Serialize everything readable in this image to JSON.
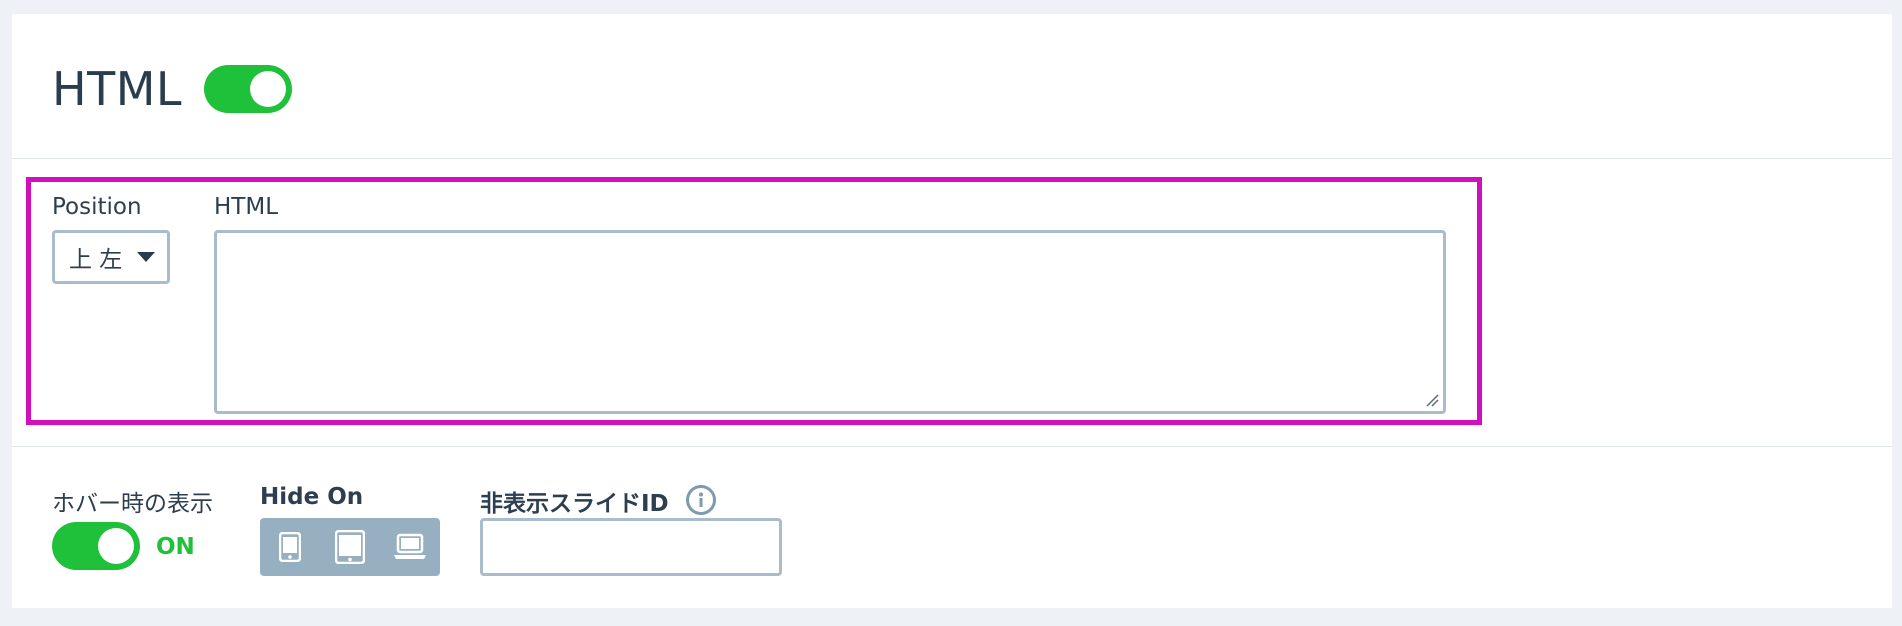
{
  "header": {
    "title": "HTML",
    "enabled": true
  },
  "position": {
    "label": "Position",
    "selected": "上 左"
  },
  "html_field": {
    "label": "HTML",
    "value": ""
  },
  "hover_display": {
    "label": "ホバー時の表示",
    "state_text": "ON",
    "enabled": true
  },
  "hide_on": {
    "label": "Hide On",
    "devices": [
      "mobile-icon",
      "tablet-icon",
      "laptop-icon"
    ]
  },
  "hidden_slide_id": {
    "label": "非表示スライドID",
    "value": ""
  },
  "colors": {
    "accent_green": "#1fc03a",
    "highlight_magenta": "#d20fbc",
    "input_border": "#a8bccb"
  }
}
